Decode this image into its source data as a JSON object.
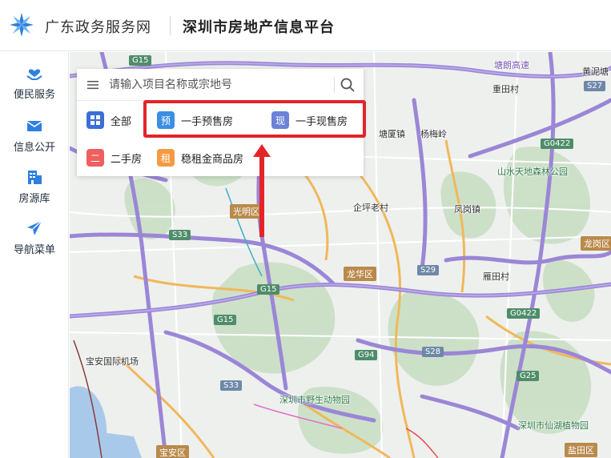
{
  "header": {
    "brand": "广东政务服务网",
    "platform": "深圳市房地产信息平台"
  },
  "sidebar": {
    "items": [
      {
        "label": "便民服务",
        "icon": "heart-hands-icon"
      },
      {
        "label": "信息公开",
        "icon": "envelope-icon"
      },
      {
        "label": "房源库",
        "icon": "building-icon"
      },
      {
        "label": "导航菜单",
        "icon": "paper-plane-icon"
      }
    ]
  },
  "search": {
    "placeholder": "请输入项目名称或宗地号",
    "value": ""
  },
  "categories": [
    {
      "badge": "",
      "label": "全部",
      "color": "#3b6fd8"
    },
    {
      "badge": "预",
      "label": "一手预售房",
      "color": "#3a8fe4"
    },
    {
      "badge": "现",
      "label": "一手现售房",
      "color": "#6b82d8"
    },
    {
      "badge": "二",
      "label": "二手房",
      "color": "#ef5f5f"
    },
    {
      "badge": "租",
      "label": "稳租金商品房",
      "color": "#f59a43"
    }
  ],
  "map": {
    "labels": {
      "s15": "G15",
      "tanglang": "塘朗高速",
      "huangni": "黄泥塘",
      "chongtou": "重田村",
      "s27": "S27",
      "tangxia": "塘厦镇",
      "yangmeiling": "杨梅岭",
      "g0422a": "G0422",
      "shanshui": "山水天地森林公园",
      "qiping": "企坪老村",
      "fenggang": "凤岗镇",
      "guangming": "光明区",
      "s33a": "S33",
      "longgang": "龙岗区",
      "s29": "S29",
      "longhua": "龙华区",
      "yantian": "雁田村",
      "g15b": "G15",
      "g0422b": "G0422",
      "g15c": "G15",
      "airport": "宝安国际机场",
      "g94": "G94",
      "s28": "S28",
      "g25": "G25",
      "s33b": "S33",
      "zoo": "深圳市野生动物园",
      "botanical": "深圳市仙湖植物园",
      "baoan": "宝安区",
      "yantian_d": "盐田区"
    }
  }
}
